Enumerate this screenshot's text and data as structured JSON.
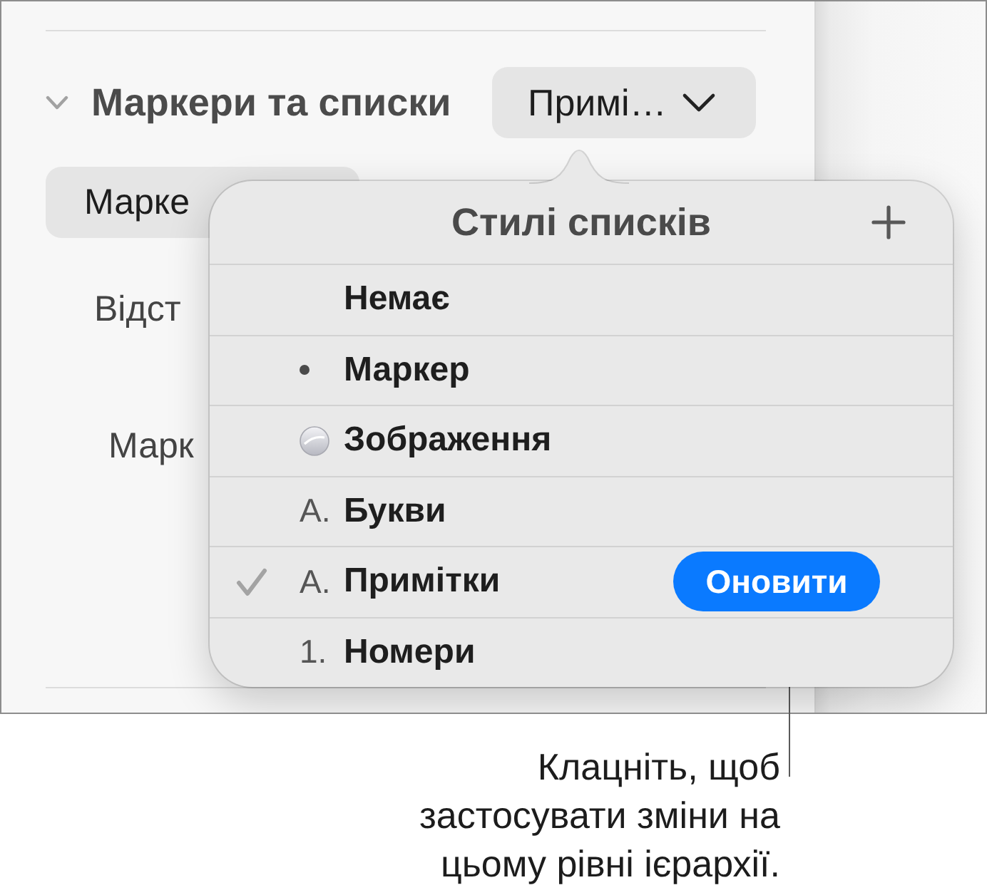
{
  "panel": {
    "section": {
      "title": "Маркери та списки",
      "expanded": true,
      "style_popup": "Примі…"
    },
    "controls": [
      {
        "kind": "popup",
        "text": "Марке"
      },
      {
        "kind": "label",
        "text": "Відст"
      },
      {
        "kind": "label",
        "text": "Марк"
      }
    ]
  },
  "popover": {
    "title": "Стилі списків",
    "styles": [
      {
        "kind": "none",
        "label": "Немає",
        "selected": false
      },
      {
        "kind": "bullet",
        "label": "Маркер",
        "selected": false
      },
      {
        "kind": "image",
        "label": "Зображення",
        "selected": false
      },
      {
        "kind": "text",
        "prefix": "A.",
        "label": "Букви",
        "selected": false
      },
      {
        "kind": "text",
        "prefix": "A.",
        "label": "Примітки",
        "selected": true,
        "update_button": "Оновити"
      },
      {
        "kind": "text",
        "prefix": "1.",
        "label": "Номери",
        "selected": false
      }
    ]
  },
  "callout": {
    "text": "Клацніть, щоб застосувати зміни на цьому рівні ієрархії."
  }
}
